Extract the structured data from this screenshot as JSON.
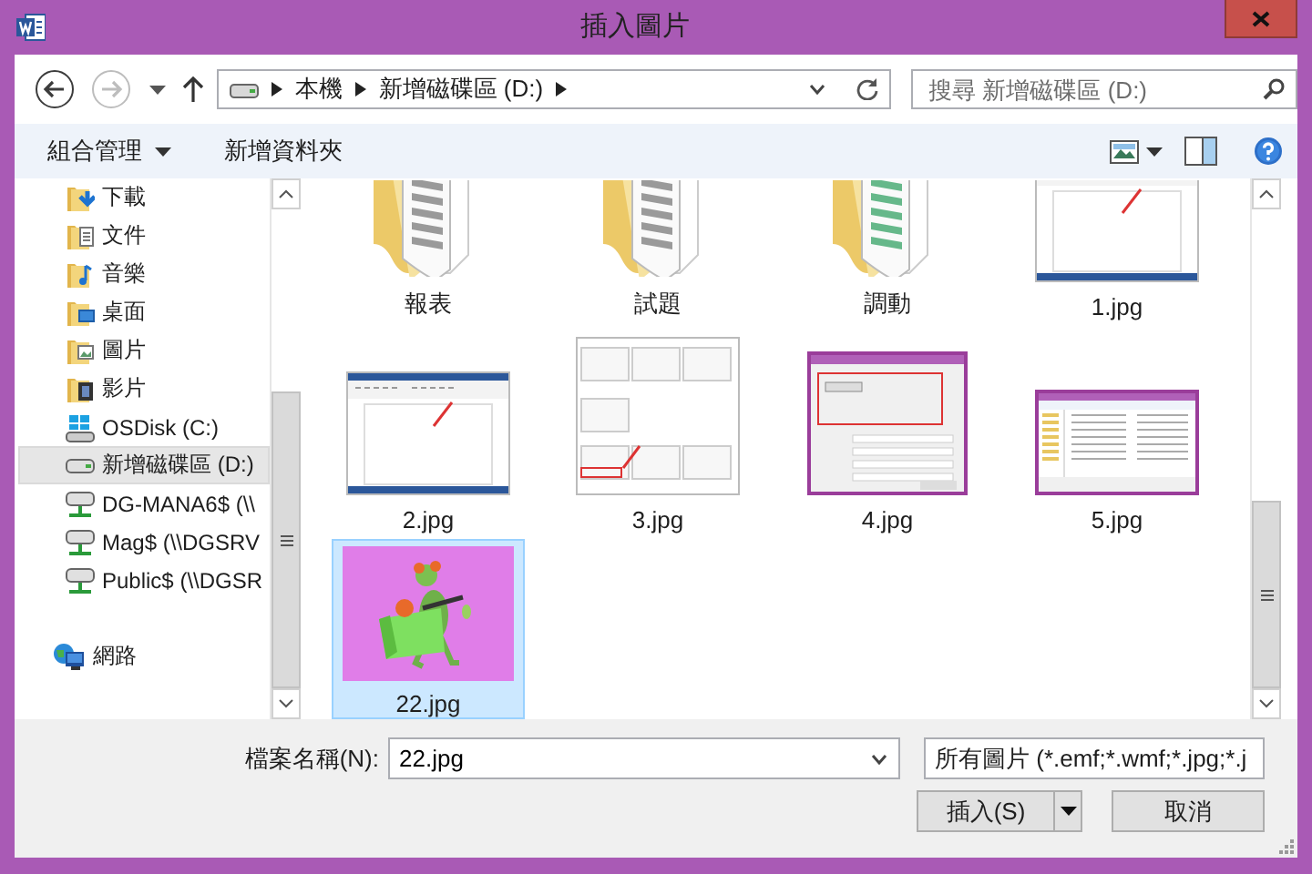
{
  "window": {
    "title": "插入圖片"
  },
  "history": {
    "back_enabled": true,
    "forward_enabled": false
  },
  "address": {
    "segments": [
      "本機",
      "新增磁碟區 (D:)"
    ]
  },
  "search": {
    "placeholder": "搜尋 新增磁碟區 (D:)"
  },
  "toolbar": {
    "buttons": [
      {
        "label": "組合管理",
        "menu": true
      },
      {
        "label": "新增資料夾",
        "menu": false
      }
    ]
  },
  "nav": {
    "items": [
      {
        "label": "下載",
        "kind": "download",
        "selected": false
      },
      {
        "label": "文件",
        "kind": "documents",
        "selected": false
      },
      {
        "label": "音樂",
        "kind": "music",
        "selected": false
      },
      {
        "label": "桌面",
        "kind": "desktop",
        "selected": false
      },
      {
        "label": "圖片",
        "kind": "pictures",
        "selected": false
      },
      {
        "label": "影片",
        "kind": "videos",
        "selected": false
      },
      {
        "label": "OSDisk (C:)",
        "kind": "osdisk",
        "selected": false
      },
      {
        "label": "新增磁碟區 (D:)",
        "kind": "drive",
        "selected": true
      },
      {
        "label": "DG-MANA6$ (\\\\",
        "kind": "netdrive",
        "selected": false
      },
      {
        "label": "Mag$ (\\\\DGSRV",
        "kind": "netdrive",
        "selected": false
      },
      {
        "label": "Public$ (\\\\DGSR",
        "kind": "netdrive",
        "selected": false
      },
      {
        "label": "網路",
        "kind": "network",
        "selected": false
      }
    ]
  },
  "files": [
    {
      "name": "報表",
      "kind": "folder",
      "selected": false
    },
    {
      "name": "試題",
      "kind": "folder",
      "selected": false
    },
    {
      "name": "調動",
      "kind": "sheetfolder",
      "selected": false
    },
    {
      "name": "1.jpg",
      "kind": "doc",
      "selected": false
    },
    {
      "name": "2.jpg",
      "kind": "doc",
      "selected": false
    },
    {
      "name": "3.jpg",
      "kind": "gallery",
      "selected": false
    },
    {
      "name": "4.jpg",
      "kind": "settings",
      "selected": false
    },
    {
      "name": "5.jpg",
      "kind": "explorer",
      "selected": false
    },
    {
      "name": "22.jpg",
      "kind": "picture",
      "selected": true
    }
  ],
  "footer": {
    "file_name_label": "檔案名稱(N):",
    "file_name": "22.jpg",
    "file_type": "所有圖片 (*.emf;*.wmf;*.jpg;*.j",
    "buttons": [
      {
        "label": "插入(S)",
        "kind": "split"
      },
      {
        "label": "取消",
        "kind": "plain"
      }
    ]
  }
}
